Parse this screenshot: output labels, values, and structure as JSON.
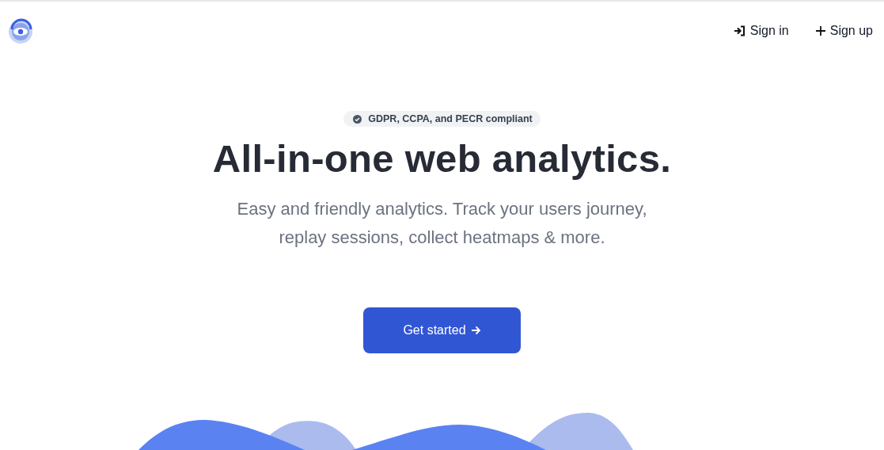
{
  "nav": {
    "links": [
      {
        "kind": "signin",
        "label": "Sign in"
      },
      {
        "kind": "signup",
        "label": "Sign up"
      }
    ]
  },
  "hero": {
    "badge": "GDPR, CCPA, and PECR compliant",
    "title": "All-in-one web analytics.",
    "subtitle": "Easy and friendly analytics. Track your users journey, replay sessions, collect heatmaps & more.",
    "cta": "Get started"
  }
}
